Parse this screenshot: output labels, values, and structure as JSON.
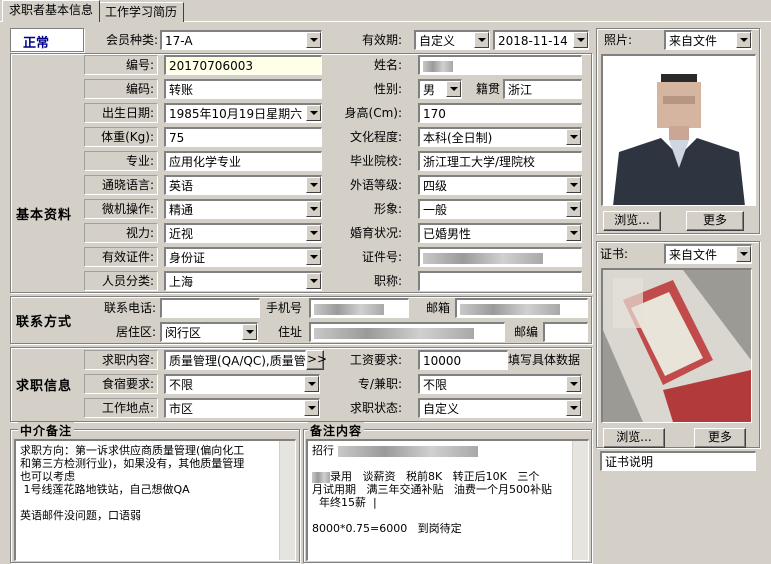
{
  "tabs": [
    "求职者基本信息",
    "工作学习简历"
  ],
  "status": "正常",
  "top_row": {
    "member_type_label": "会员种类:",
    "member_type_value": "17-A",
    "validity_label": "有效期:",
    "validity_mode": "自定义",
    "validity_date": "2018-11-14"
  },
  "sections": {
    "basic": "基本资料",
    "contact": "联系方式",
    "job": "求职信息",
    "agent_notes": "中介备注",
    "remarks": "备注内容"
  },
  "basic": {
    "serial_label": "编号:",
    "serial_value": "20170706003",
    "name_label": "姓名:",
    "code_label": "编码:",
    "code_value": "转账",
    "gender_label": "性别:",
    "gender_value": "男",
    "native_label": "籍贯",
    "native_value": "浙江",
    "birth_label": "出生日期:",
    "birth_value": "1985年10月19日星期六",
    "height_label": "身高(Cm):",
    "height_value": "170",
    "weight_label": "体重(Kg):",
    "weight_value": "75",
    "edu_label": "文化程度:",
    "edu_value": "本科(全日制)",
    "major_label": "专业:",
    "major_value": "应用化学专业",
    "school_label": "毕业院校:",
    "school_value": "浙江理工大学/理院校",
    "lang_label": "通晓语言:",
    "lang_value": "英语",
    "foreign_label": "外语等级:",
    "foreign_value": "四级",
    "pc_label": "微机操作:",
    "pc_value": "精通",
    "look_label": "形象:",
    "look_value": "一般",
    "vision_label": "视力:",
    "vision_value": "近视",
    "marital_label": "婚育状况:",
    "marital_value": "已婚男性",
    "id_type_label": "有效证件:",
    "id_type_value": "身份证",
    "id_no_label": "证件号:",
    "category_label": "人员分类:",
    "category_value": "上海",
    "title_label": "职称:"
  },
  "contact": {
    "phone_label": "联系电话:",
    "mobile_label": "手机号",
    "email_label": "邮箱",
    "district_label": "居住区:",
    "district_value": "闵行区",
    "address_label": "住址",
    "zip_label": "邮编"
  },
  "job": {
    "content_label": "求职内容:",
    "content_value": "质量管理(QA/QC),质量管",
    "more": ">>",
    "salary_label": "工资要求:",
    "salary_value": "10000",
    "salary_hint": "填写具体数据",
    "board_label": "食宿要求:",
    "board_value": "不限",
    "parttime_label": "专/兼职:",
    "parttime_value": "不限",
    "location_label": "工作地点:",
    "location_value": "市区",
    "state_label": "求职状态:",
    "state_value": "自定义"
  },
  "agent_notes_text": "求职方向：第一诉求供应商质量管理(偏向化工\n和第三方检测行业)，如果没有，其他质量管理\n也可以考虑\n 1号线莲花路地铁站，自己想做QA\n\n英语邮件没问题，口语弱",
  "remarks": {
    "line1": "招行",
    "line2": "录用   谈薪资   税前8K   转正后10K   三个",
    "line3": "月试用期   满三年交通补贴   油费一个月500补贴",
    "line4": "  年终15薪  |",
    "line5": "8000*0.75=6000   到岗待定"
  },
  "photo": {
    "label": "照片:",
    "source": "来自文件",
    "browse": "浏览...",
    "more": "更多"
  },
  "cert": {
    "label": "证书:",
    "source": "来自文件",
    "browse": "浏览...",
    "more": "更多",
    "desc": "证书说明"
  }
}
